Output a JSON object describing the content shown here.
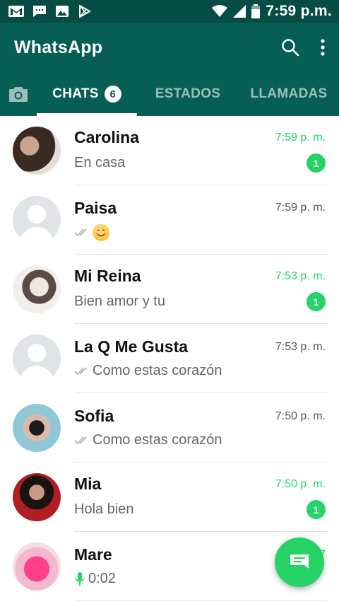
{
  "status_bar": {
    "time": "7:59 p.m.",
    "icons": [
      "gmail-icon",
      "message-icon",
      "gallery-icon",
      "play-store-icon",
      "wifi-icon",
      "signal-icon",
      "battery-icon"
    ]
  },
  "app_bar": {
    "title": "WhatsApp",
    "icons": [
      "search-icon",
      "more-vertical-icon"
    ]
  },
  "tabs": [
    {
      "label": "CHATS",
      "badge": "6",
      "active": true
    },
    {
      "label": "ESTADOS",
      "active": false
    },
    {
      "label": "LLAMADAS",
      "active": false
    }
  ],
  "chats": [
    {
      "name": "Carolina",
      "time": "7:59 p. m.",
      "message": "En casa",
      "unread": "1",
      "avatar": "photo"
    },
    {
      "name": "Paisa",
      "time": "7:59 p. m.",
      "message": "",
      "emoji": "smiling-emoji",
      "ticks": true,
      "avatar": "default"
    },
    {
      "name": "Mi Reina",
      "time": "7:53 p. m.",
      "message": "Bien amor y tu",
      "unread": "1",
      "avatar": "photo"
    },
    {
      "name": "La Q Me Gusta",
      "time": "7:53 p. m.",
      "message": "Como estas corazón",
      "ticks": true,
      "avatar": "default"
    },
    {
      "name": "Sofia",
      "time": "7:50 p. m.",
      "message": "Como estas corazón",
      "ticks": true,
      "avatar": "photo"
    },
    {
      "name": "Mia",
      "time": "7:50 p. m.",
      "message": "Hola bien",
      "unread": "1",
      "avatar": "photo"
    },
    {
      "name": "Mare",
      "time": "7",
      "message": "0:02",
      "mic": true,
      "avatar": "photo"
    }
  ],
  "colors": {
    "primary": "#075e54",
    "status_bar": "#054d44",
    "accent": "#25d366"
  },
  "fab_icon": "new-chat-icon"
}
